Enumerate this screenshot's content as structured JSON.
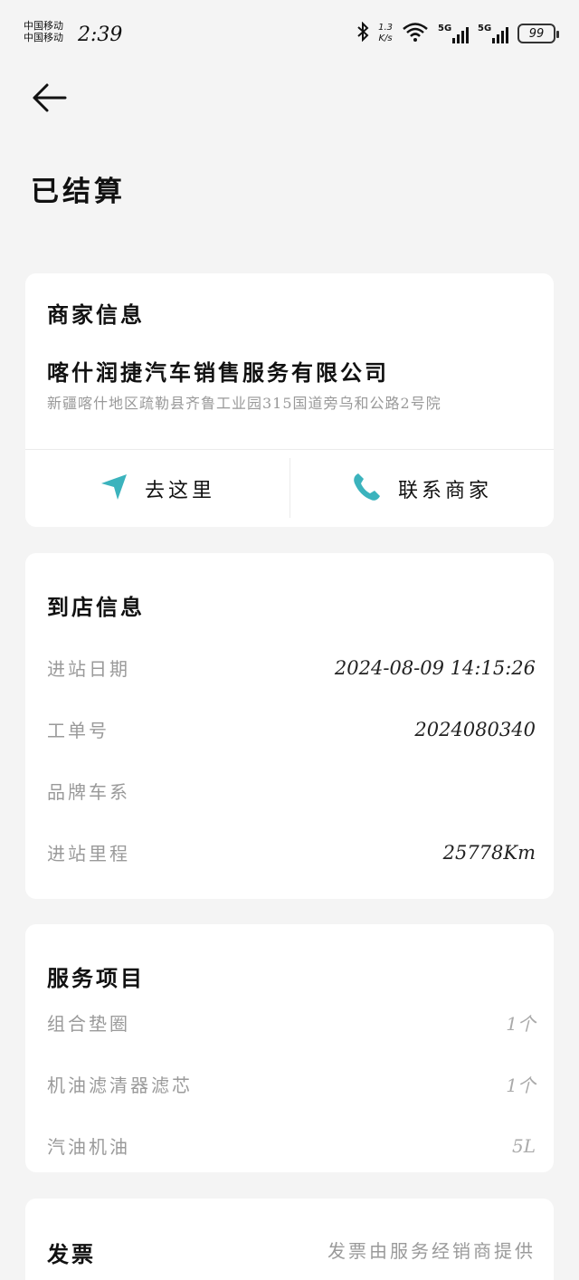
{
  "status_bar": {
    "carrier_1": "中国移动",
    "carrier_2": "中国移动",
    "time": "2:39",
    "net_speed_value": "1.3",
    "net_speed_unit": "K/s",
    "sim1_tag": "5G",
    "sim2_tag": "5G",
    "battery": "99",
    "icons": [
      "bluetooth-icon",
      "wifi-icon",
      "signal-icon",
      "battery-icon"
    ]
  },
  "header": {
    "title": "已结算"
  },
  "merchant": {
    "section_title": "商家信息",
    "name": "喀什润捷汽车销售服务有限公司",
    "address": "新疆喀什地区疏勒县齐鲁工业园315国道旁乌和公路2号院",
    "navigate_label": "去这里",
    "contact_label": "联系商家"
  },
  "arrival": {
    "section_title": "到店信息",
    "rows": [
      {
        "label": "进站日期",
        "value": "2024-08-09 14:15:26"
      },
      {
        "label": "工单号",
        "value": "2024080340"
      },
      {
        "label": "品牌车系",
        "value": ""
      },
      {
        "label": "进站里程",
        "value": "25778Km"
      }
    ]
  },
  "service": {
    "section_title": "服务项目",
    "items": [
      {
        "label": "组合垫圈",
        "value": "1个"
      },
      {
        "label": "机油滤清器滤芯",
        "value": "1个"
      },
      {
        "label": "汽油机油",
        "value": "5L"
      }
    ]
  },
  "invoice": {
    "section_title": "发票",
    "note": "发票由服务经销商提供"
  },
  "colors": {
    "background": "#f4f4f4",
    "card": "#ffffff",
    "accent_teal": "#3bb3bd",
    "muted_text": "#9a9a9a"
  }
}
